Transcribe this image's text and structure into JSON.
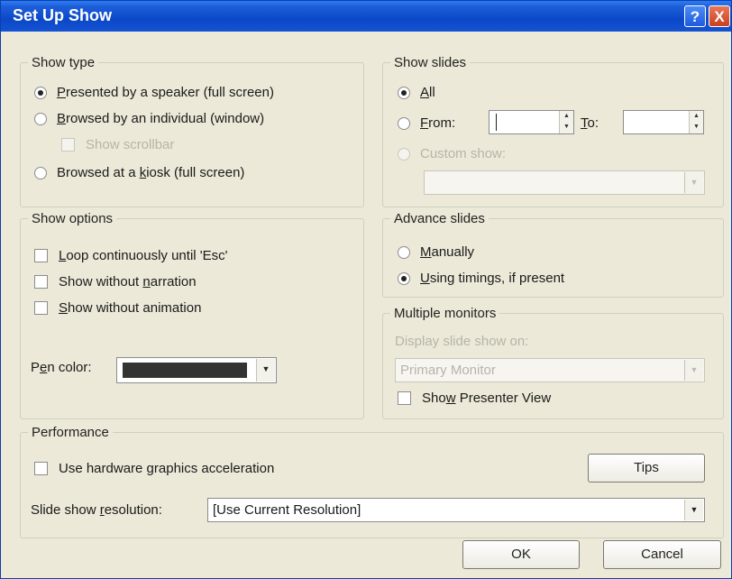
{
  "window": {
    "title": "Set Up Show",
    "help_label": "?",
    "close_label": "X"
  },
  "show_type": {
    "legend": "Show type",
    "options": [
      {
        "label_pre": "",
        "key": "P",
        "label_post": "resented by a speaker (full screen)",
        "selected": true
      },
      {
        "label_pre": "",
        "key": "B",
        "label_post": "rowsed by an individual (window)",
        "selected": false
      },
      {
        "label_pre": "Browsed at a ",
        "key": "k",
        "label_post": "iosk (full screen)",
        "selected": false
      }
    ],
    "show_scrollbar": "Show scrollbar"
  },
  "show_slides": {
    "legend": "Show slides",
    "all_key": "A",
    "all_rest": "ll",
    "from_key": "F",
    "from_rest": "rom:",
    "to_key": "T",
    "to_rest": "o:",
    "custom_show": "Custom show:",
    "custom_show_value": ""
  },
  "show_options": {
    "legend": "Show options",
    "loop_key": "L",
    "loop_rest": "oop continuously until 'Esc'",
    "narration_pre": "Show without ",
    "narration_key": "n",
    "narration_rest": "arration",
    "animation_key": "S",
    "animation_rest": "how without animation",
    "pen_pre": "P",
    "pen_key": "e",
    "pen_rest": "n color:",
    "pen_color": "#333333"
  },
  "advance_slides": {
    "legend": "Advance slides",
    "manually_key": "M",
    "manually_rest": "anually",
    "timings_key": "U",
    "timings_rest": "sing timings, if present",
    "selected": "timings"
  },
  "multiple_monitors": {
    "legend": "Multiple monitors",
    "display_label": "Display slide show on:",
    "monitor": "Primary Monitor",
    "presenter_pre": "Sho",
    "presenter_key": "w",
    "presenter_rest": " Presenter View"
  },
  "performance": {
    "legend": "Performance",
    "hw_accel": "Use hardware graphics acceleration",
    "tips": "Tips",
    "res_pre": "Slide show ",
    "res_key": "r",
    "res_rest": "esolution:",
    "resolution": "[Use Current Resolution]"
  },
  "buttons": {
    "ok": "OK",
    "cancel": "Cancel"
  }
}
